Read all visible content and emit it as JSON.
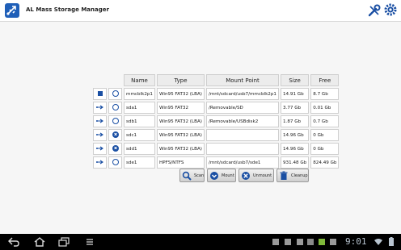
{
  "app": {
    "title": "AL Mass Storage Manager",
    "icon": "usb-app-icon"
  },
  "header": {
    "tools_icon": "wrench-screwdriver-icon",
    "settings_icon": "gear-icon"
  },
  "table": {
    "columns": [
      "Name",
      "Type",
      "Mount Point",
      "Size",
      "Free"
    ],
    "rows": [
      {
        "icon": "sdcard-icon",
        "state": "mounted",
        "name": "mmcblk2p1",
        "type": "Win95 FAT32 (LBA)",
        "mount": "/mnt/sdcard/usb7/mmcblk2p1",
        "size": "14.91 Gb",
        "free": "8.7 Gb"
      },
      {
        "icon": "usb-icon",
        "state": "mounted",
        "name": "sda1",
        "type": "Win95 FAT32",
        "mount": "/Removable/SD",
        "size": "3.77 Gb",
        "free": "0.01 Gb"
      },
      {
        "icon": "usb-icon",
        "state": "mounted",
        "name": "sdb1",
        "type": "Win95 FAT32 (LBA)",
        "mount": "/Removable/USBdisk2",
        "size": "1.87 Gb",
        "free": "0.7 Gb"
      },
      {
        "icon": "usb-icon",
        "state": "unmounted",
        "name": "sdc1",
        "type": "Win95 FAT32 (LBA)",
        "mount": "",
        "size": "14.96 Gb",
        "free": "0 Gb"
      },
      {
        "icon": "usb-icon",
        "state": "unmounted",
        "name": "sdd1",
        "type": "Win95 FAT32 (LBA)",
        "mount": "",
        "size": "14.96 Gb",
        "free": "0 Gb"
      },
      {
        "icon": "usb-icon",
        "state": "mounted",
        "name": "sde1",
        "type": "HPFS/NTFS",
        "mount": "/mnt/sdcard/usb7/sde1",
        "size": "931.48 Gb",
        "free": "824.49 Gb"
      }
    ]
  },
  "actions": {
    "scan": "Scan",
    "mount": "Mount",
    "unmount": "Unmount",
    "cleanup": "Cleanup"
  },
  "statusbar": {
    "time": "9:01"
  },
  "colors": {
    "accent": "#1a4fa3",
    "navbar": "#000000"
  }
}
